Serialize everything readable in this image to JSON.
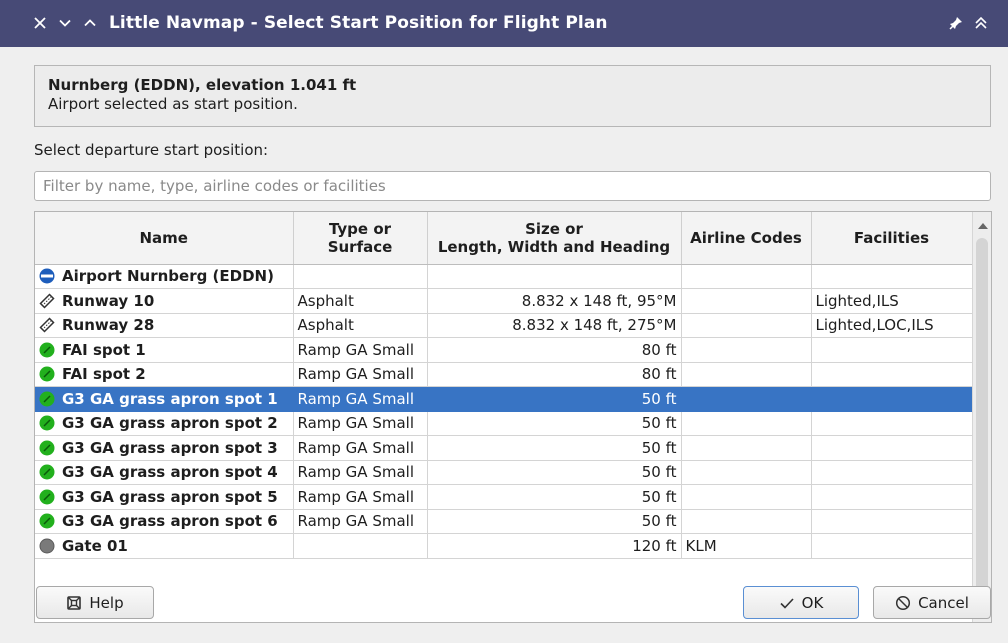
{
  "titlebar": {
    "title": "Little Navmap - Select Start Position for Flight Plan",
    "close_icon": "close-icon",
    "minimize_icon": "chevron-down-icon",
    "maximize_icon": "chevron-up-icon",
    "pin_icon": "pin-icon",
    "keep_above_icon": "double-chevron-up-icon"
  },
  "info": {
    "title": "Nurnberg (EDDN), elevation 1.041 ft",
    "subtitle": "Airport selected as start position."
  },
  "select_label": "Select departure start position:",
  "filter": {
    "placeholder": "Filter by name, type, airline codes or facilities",
    "value": ""
  },
  "table": {
    "columns": [
      {
        "line1": "Name",
        "line2": ""
      },
      {
        "line1": "Type or",
        "line2": "Surface"
      },
      {
        "line1": "Size or",
        "line2": "Length, Width and Heading"
      },
      {
        "line1": "Airline Codes",
        "line2": ""
      },
      {
        "line1": "Facilities",
        "line2": ""
      }
    ],
    "rows": [
      {
        "icon": "airport-icon",
        "name": "Airport Nurnberg (EDDN)",
        "type": "",
        "size": "",
        "airline": "",
        "facilities": ""
      },
      {
        "icon": "runway-icon",
        "name": "Runway 10",
        "type": "Asphalt",
        "size": "8.832 x 148 ft, 95°M",
        "airline": "",
        "facilities": "Lighted,ILS"
      },
      {
        "icon": "runway-icon",
        "name": "Runway 28",
        "type": "Asphalt",
        "size": "8.832 x 148 ft, 275°M",
        "airline": "",
        "facilities": "Lighted,LOC,ILS"
      },
      {
        "icon": "parking-green-icon",
        "name": "FAI spot 1",
        "type": "Ramp GA Small",
        "size": "80 ft",
        "airline": "",
        "facilities": ""
      },
      {
        "icon": "parking-green-icon",
        "name": "FAI spot 2",
        "type": "Ramp GA Small",
        "size": "80 ft",
        "airline": "",
        "facilities": ""
      },
      {
        "icon": "parking-green-icon",
        "name": "G3 GA grass apron spot 1",
        "type": "Ramp GA Small",
        "size": "50 ft",
        "airline": "",
        "facilities": "",
        "selected": true
      },
      {
        "icon": "parking-green-icon",
        "name": "G3 GA grass apron spot 2",
        "type": "Ramp GA Small",
        "size": "50 ft",
        "airline": "",
        "facilities": ""
      },
      {
        "icon": "parking-green-icon",
        "name": "G3 GA grass apron spot 3",
        "type": "Ramp GA Small",
        "size": "50 ft",
        "airline": "",
        "facilities": ""
      },
      {
        "icon": "parking-green-icon",
        "name": "G3 GA grass apron spot 4",
        "type": "Ramp GA Small",
        "size": "50 ft",
        "airline": "",
        "facilities": ""
      },
      {
        "icon": "parking-green-icon",
        "name": "G3 GA grass apron spot 5",
        "type": "Ramp GA Small",
        "size": "50 ft",
        "airline": "",
        "facilities": ""
      },
      {
        "icon": "parking-green-icon",
        "name": "G3 GA grass apron spot 6",
        "type": "Ramp GA Small",
        "size": "50 ft",
        "airline": "",
        "facilities": ""
      },
      {
        "icon": "gate-gray-icon",
        "name": "Gate 01",
        "type": "",
        "size": "120 ft",
        "airline": "KLM",
        "facilities": ""
      }
    ]
  },
  "buttons": {
    "help": {
      "label": "Help",
      "icon": "lifebuoy-icon"
    },
    "ok": {
      "label": "OK",
      "icon": "checkmark-icon"
    },
    "cancel": {
      "label": "Cancel",
      "icon": "cancel-circle-icon"
    }
  },
  "colors": {
    "titlebar": "#474a76",
    "selection": "#3874c4",
    "parking_green": "#22b01d",
    "airport_blue": "#1d5dbb",
    "gate_gray": "#7a7a7a"
  }
}
